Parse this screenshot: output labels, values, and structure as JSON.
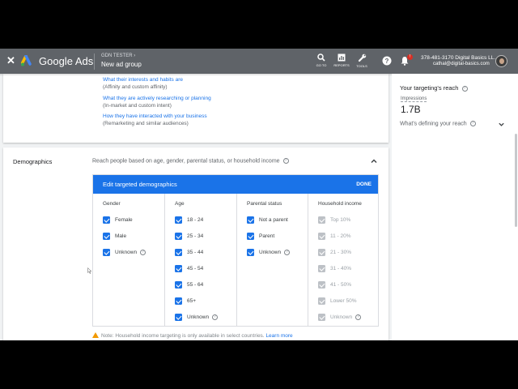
{
  "topbar": {
    "brand": "Google Ads",
    "crumb_parent": "GDN TESTER",
    "crumb_current": "New ad group",
    "tools": [
      {
        "icon": "search-icon",
        "label": "GO TO"
      },
      {
        "icon": "reports-icon",
        "label": "REPORTS"
      },
      {
        "icon": "wrench-icon",
        "label": "TOOLS"
      }
    ],
    "notification_badge": "!",
    "account_line1": "378-481-3170 Digital Basics LL...",
    "account_line2": "cathal@digital-basics.com"
  },
  "audiences": [
    {
      "link": "What their interests and habits are",
      "sub": "(Affinity and custom affinity)"
    },
    {
      "link": "What they are actively researching or planning",
      "sub": "(In-market and custom intent)"
    },
    {
      "link": "How they have interacted with your business",
      "sub": "(Remarketing and similar audiences)"
    }
  ],
  "demographics": {
    "title": "Demographics",
    "description": "Reach people based on age, gender, parental status, or household income",
    "edit_title": "Edit targeted demographics",
    "done_label": "DONE",
    "columns": [
      {
        "header": "Gender",
        "options": [
          {
            "label": "Female",
            "checked": true,
            "disabled": false
          },
          {
            "label": "Male",
            "checked": true,
            "disabled": false
          },
          {
            "label": "Unknown",
            "checked": true,
            "disabled": false,
            "help": true
          }
        ]
      },
      {
        "header": "Age",
        "options": [
          {
            "label": "18 - 24",
            "checked": true,
            "disabled": false
          },
          {
            "label": "25 - 34",
            "checked": true,
            "disabled": false
          },
          {
            "label": "35 - 44",
            "checked": true,
            "disabled": false
          },
          {
            "label": "45 - 54",
            "checked": true,
            "disabled": false
          },
          {
            "label": "55 - 64",
            "checked": true,
            "disabled": false
          },
          {
            "label": "65+",
            "checked": true,
            "disabled": false
          },
          {
            "label": "Unknown",
            "checked": true,
            "disabled": false,
            "help": true
          }
        ]
      },
      {
        "header": "Parental status",
        "options": [
          {
            "label": "Not a parent",
            "checked": true,
            "disabled": false
          },
          {
            "label": "Parent",
            "checked": true,
            "disabled": false
          },
          {
            "label": "Unknown",
            "checked": true,
            "disabled": false,
            "help": true
          }
        ]
      },
      {
        "header": "Household income",
        "options": [
          {
            "label": "Top 10%",
            "checked": true,
            "disabled": true
          },
          {
            "label": "11 - 20%",
            "checked": true,
            "disabled": true
          },
          {
            "label": "21 - 30%",
            "checked": true,
            "disabled": true
          },
          {
            "label": "31 - 40%",
            "checked": true,
            "disabled": true
          },
          {
            "label": "41 - 50%",
            "checked": true,
            "disabled": true
          },
          {
            "label": "Lower 50%",
            "checked": true,
            "disabled": true
          },
          {
            "label": "Unknown",
            "checked": true,
            "disabled": true,
            "help": true
          }
        ]
      }
    ],
    "note_text": "Note: Household income targeting is only available in select countries.",
    "note_link": "Learn more"
  },
  "reach_panel": {
    "title": "Your targeting's reach",
    "impressions_label": "Impressions",
    "impressions_value": "1.7B",
    "defining_label": "What's defining your reach"
  },
  "colors": {
    "accent": "#1a73e8",
    "topbar": "#5f6368",
    "warning": "#f29900"
  }
}
